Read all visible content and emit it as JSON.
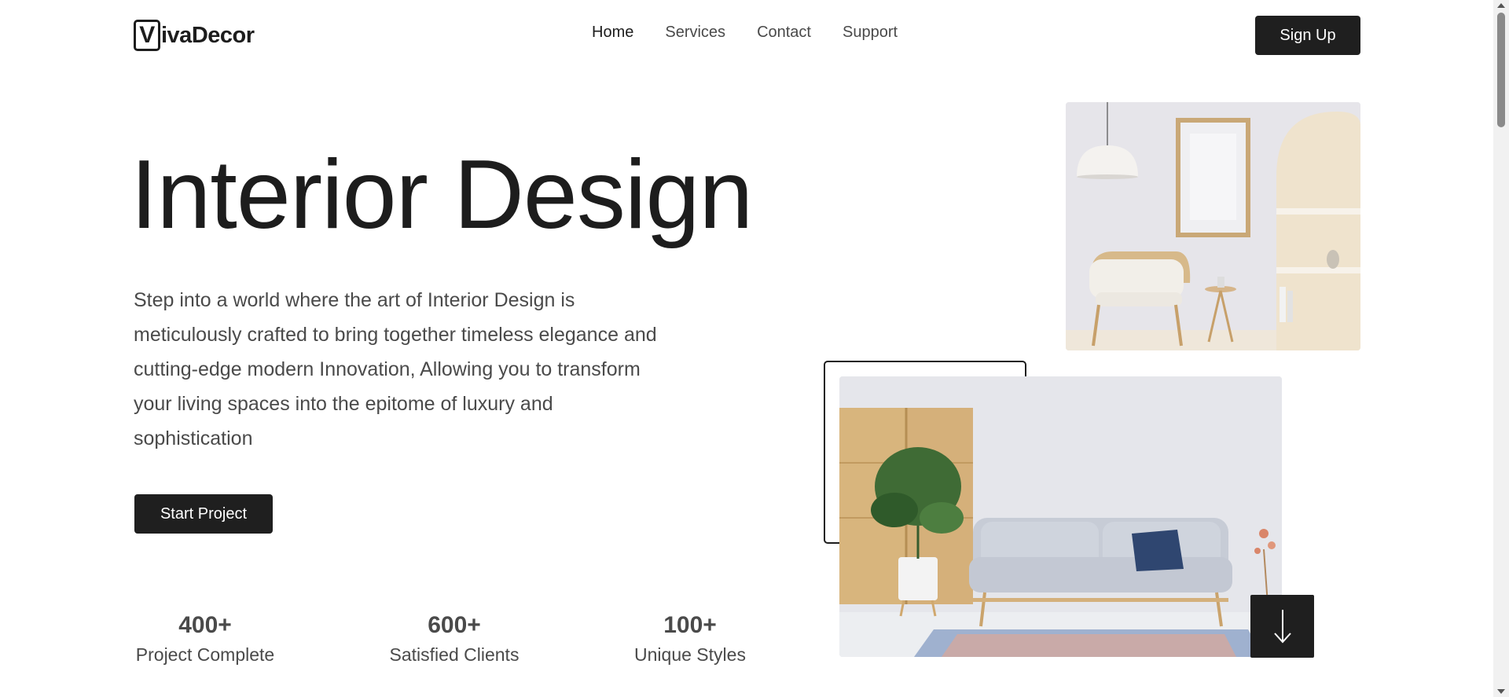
{
  "brand": {
    "logo_initial": "V",
    "logo_rest": "ivaDecor"
  },
  "nav": {
    "items": [
      {
        "label": "Home",
        "active": true
      },
      {
        "label": "Services",
        "active": false
      },
      {
        "label": "Contact",
        "active": false
      },
      {
        "label": "Support",
        "active": false
      }
    ],
    "signup_label": "Sign Up"
  },
  "hero": {
    "title": "Interior Design",
    "description": "Step into a world where the art of Interior Design is meticulously crafted to bring together timeless elegance and cutting-edge modern Innovation, Allowing you to transform your living spaces into the epitome of luxury and sophistication",
    "cta_label": "Start Project"
  },
  "stats": [
    {
      "value": "400+",
      "label": "Project Complete"
    },
    {
      "value": "600+",
      "label": "Satisfied Clients"
    },
    {
      "value": "100+",
      "label": "Unique Styles"
    }
  ],
  "images": {
    "top": "living-room-armchair-photo",
    "bottom": "living-room-sofa-photo"
  },
  "icons": {
    "scroll_down": "arrow-down-icon"
  },
  "colors": {
    "primary": "#1f1f1f",
    "text": "#1d1d1d",
    "muted": "#4a4a4a",
    "background": "#ffffff"
  }
}
